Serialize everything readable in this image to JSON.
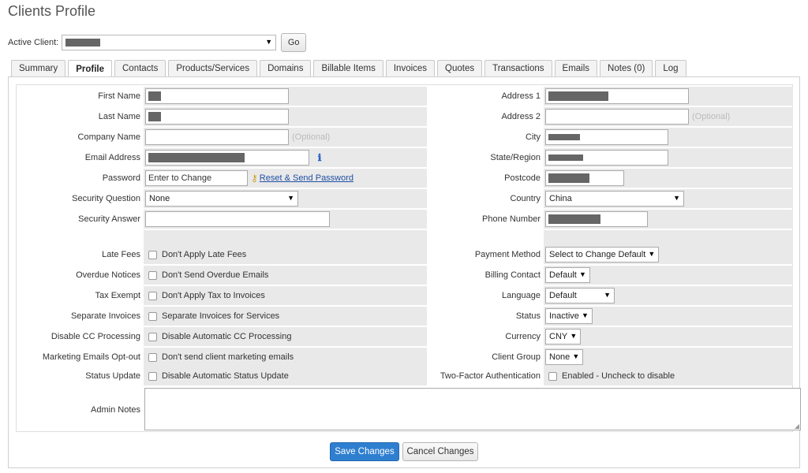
{
  "page_title": "Clients Profile",
  "active_client": {
    "label": "Active Client:",
    "go_label": "Go"
  },
  "tabs": [
    {
      "label": "Summary",
      "active": false
    },
    {
      "label": "Profile",
      "active": true
    },
    {
      "label": "Contacts",
      "active": false
    },
    {
      "label": "Products/Services",
      "active": false
    },
    {
      "label": "Domains",
      "active": false
    },
    {
      "label": "Billable Items",
      "active": false
    },
    {
      "label": "Invoices",
      "active": false
    },
    {
      "label": "Quotes",
      "active": false
    },
    {
      "label": "Transactions",
      "active": false
    },
    {
      "label": "Emails",
      "active": false
    },
    {
      "label": "Notes (0)",
      "active": false
    },
    {
      "label": "Log",
      "active": false
    }
  ],
  "left": {
    "first_name": "First Name",
    "last_name": "Last Name",
    "company_name": "Company Name",
    "company_placeholder": "(Optional)",
    "email": "Email Address",
    "password": "Password",
    "password_value": "Enter to Change",
    "reset_link": "Reset & Send Password",
    "security_question": "Security Question",
    "security_question_value": "None",
    "security_answer": "Security Answer",
    "late_fees": "Late Fees",
    "late_fees_cb": "Don't Apply Late Fees",
    "overdue": "Overdue Notices",
    "overdue_cb": "Don't Send Overdue Emails",
    "tax_exempt": "Tax Exempt",
    "tax_exempt_cb": "Don't Apply Tax to Invoices",
    "separate_invoices": "Separate Invoices",
    "separate_invoices_cb": "Separate Invoices for Services",
    "disable_cc": "Disable CC Processing",
    "disable_cc_cb": "Disable Automatic CC Processing",
    "marketing": "Marketing Emails Opt-out",
    "marketing_cb": "Don't send client marketing emails",
    "status_update": "Status Update",
    "status_update_cb": "Disable Automatic Status Update",
    "admin_notes": "Admin Notes"
  },
  "right": {
    "address1": "Address 1",
    "address2": "Address 2",
    "address2_placeholder": "(Optional)",
    "city": "City",
    "state": "State/Region",
    "postcode": "Postcode",
    "country": "Country",
    "country_value": "China",
    "phone": "Phone Number",
    "payment_method": "Payment Method",
    "payment_method_value": "Select to Change Default",
    "billing_contact": "Billing Contact",
    "billing_contact_value": "Default",
    "language": "Language",
    "language_value": "Default",
    "status": "Status",
    "status_value": "Inactive",
    "currency": "Currency",
    "currency_value": "CNY",
    "client_group": "Client Group",
    "client_group_value": "None",
    "two_factor": "Two-Factor Authentication",
    "two_factor_cb": "Enabled - Uncheck to disable"
  },
  "buttons": {
    "save": "Save Changes",
    "cancel": "Cancel Changes"
  },
  "icons": {
    "info": "info-icon",
    "key": "key-icon",
    "dropdown": "chevron-down-icon"
  }
}
